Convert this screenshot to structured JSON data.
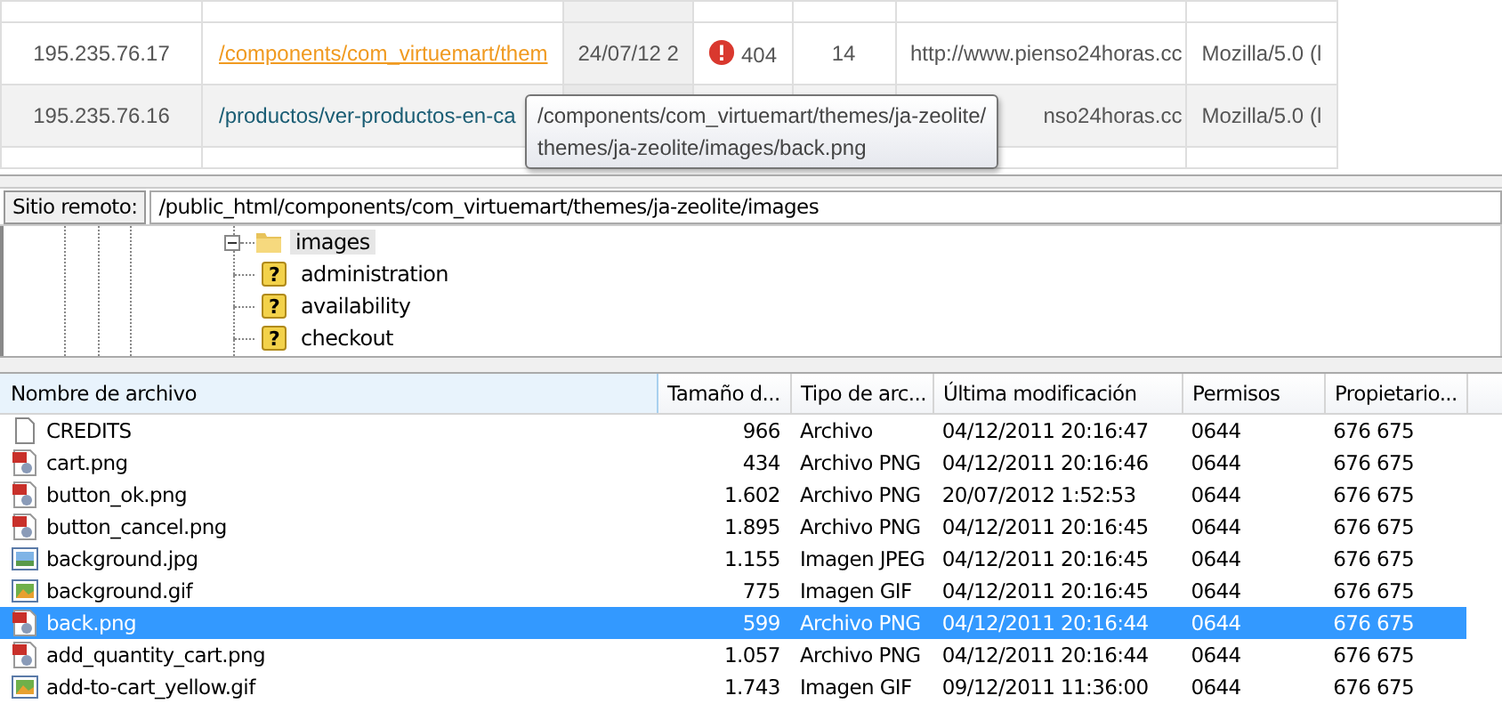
{
  "log_table": {
    "rows": [
      {
        "ip": "195.235.76.17",
        "url": "/components/com_virtuemart/them",
        "url_hover": true,
        "date": "24/07/12 2",
        "error": true,
        "status": "404",
        "hits": "14",
        "referer": "http://www.pienso24horas.cc",
        "agent": "Mozilla/5.0 (l"
      },
      {
        "ip": "195.235.76.16",
        "url": "/productos/ver-productos-en-ca",
        "url_hover": false,
        "date": "",
        "status": "",
        "hits": "",
        "referer": "nso24horas.cc",
        "agent": "Mozilla/5.0 (l"
      }
    ]
  },
  "tooltip": {
    "lines": [
      "/components/com_virtuemart/themes/ja-zeolite/",
      "themes/ja-zeolite/images/back.png"
    ]
  },
  "remote_site": {
    "label": "Sitio remoto:",
    "path": "/public_html/components/com_virtuemart/themes/ja-zeolite/images"
  },
  "tree": {
    "name": "images",
    "expanded": true,
    "children": [
      {
        "icon": "?",
        "name": "administration"
      },
      {
        "icon": "?",
        "name": "availability"
      },
      {
        "icon": "?",
        "name": "checkout"
      }
    ]
  },
  "file_list": {
    "columns": [
      "Nombre de archivo",
      "Tamaño d...",
      "Tipo de arc...",
      "Última modificación",
      "Permisos",
      "Propietario..."
    ],
    "rows": [
      {
        "kind": "file",
        "name": "CREDITS",
        "size": "966",
        "type": "Archivo",
        "modified": "04/12/2011 20:16:47",
        "perms": "0644",
        "owner": "676 675",
        "selected": false
      },
      {
        "kind": "png",
        "name": "cart.png",
        "size": "434",
        "type": "Archivo PNG",
        "modified": "04/12/2011 20:16:46",
        "perms": "0644",
        "owner": "676 675",
        "selected": false
      },
      {
        "kind": "png",
        "name": "button_ok.png",
        "size": "1.602",
        "type": "Archivo PNG",
        "modified": "20/07/2012 1:52:53",
        "perms": "0644",
        "owner": "676 675",
        "selected": false
      },
      {
        "kind": "png",
        "name": "button_cancel.png",
        "size": "1.895",
        "type": "Archivo PNG",
        "modified": "04/12/2011 20:16:45",
        "perms": "0644",
        "owner": "676 675",
        "selected": false
      },
      {
        "kind": "jpg",
        "name": "background.jpg",
        "size": "1.155",
        "type": "Imagen JPEG",
        "modified": "04/12/2011 20:16:45",
        "perms": "0644",
        "owner": "676 675",
        "selected": false
      },
      {
        "kind": "gif",
        "name": "background.gif",
        "size": "775",
        "type": "Imagen GIF",
        "modified": "04/12/2011 20:16:45",
        "perms": "0644",
        "owner": "676 675",
        "selected": false
      },
      {
        "kind": "png",
        "name": "back.png",
        "size": "599",
        "type": "Archivo PNG",
        "modified": "04/12/2011 20:16:44",
        "perms": "0644",
        "owner": "676 675",
        "selected": true
      },
      {
        "kind": "png",
        "name": "add_quantity_cart.png",
        "size": "1.057",
        "type": "Archivo PNG",
        "modified": "04/12/2011 20:16:44",
        "perms": "0644",
        "owner": "676 675",
        "selected": false
      },
      {
        "kind": "gif",
        "name": "add-to-cart_yellow.gif",
        "size": "1.743",
        "type": "Imagen GIF",
        "modified": "09/12/2011 11:36:00",
        "perms": "0644",
        "owner": "676 675",
        "selected": false
      }
    ]
  }
}
